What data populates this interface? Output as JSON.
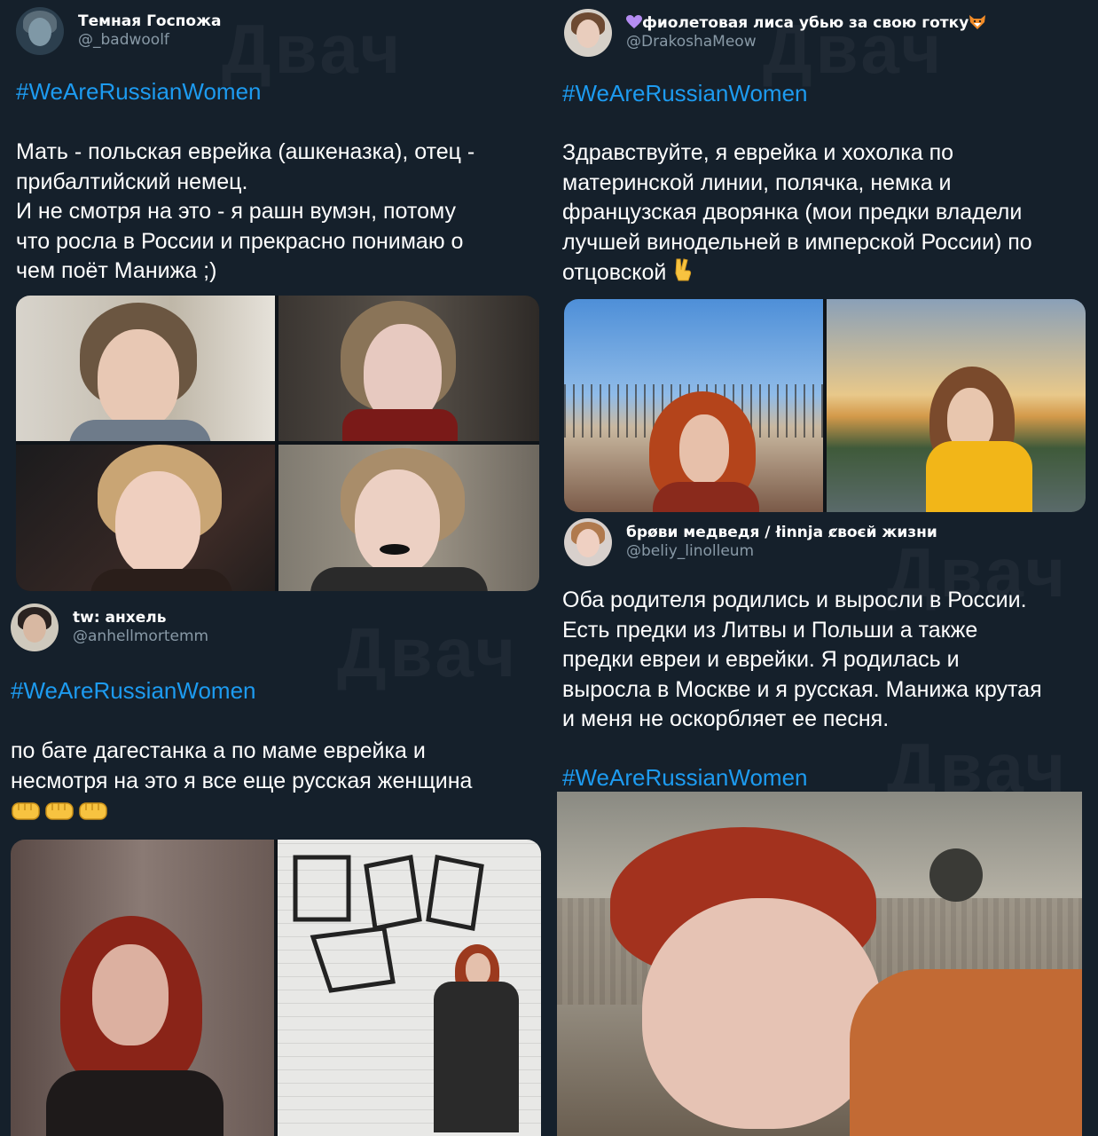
{
  "watermark": "Двач",
  "tweets": [
    {
      "display_name": "Темная Госпожа",
      "handle": "@_badwoolf",
      "hashtag": "#WeAreRussianWomen",
      "lines": [
        "Мать - польская еврейка (ашкеназка), отец -",
        "прибалтийский немец.",
        "И не смотря на это - я рашн вумэн, потому",
        "что росла в России и прекрасно понимаю о",
        "чем поёт Манижа ;)"
      ],
      "photo_count": 4
    },
    {
      "display_name": "фиолетовая лиса убью за свою готку",
      "name_prefix_icon": "purple-heart-icon",
      "name_suffix_icon": "fox-icon",
      "handle": "@DrakoshaMeow",
      "hashtag": "#WeAreRussianWomen",
      "lines": [
        "Здравствуйте, я еврейка и хохолка по",
        "материнской линии, полячка, немка и",
        "французская дворянка (мои предки владели",
        "лучшей винодельней в имперской России) по",
        "отцовской"
      ],
      "end_icon": "victory-hand-icon",
      "photo_count": 2
    },
    {
      "display_name": "tw: анхель",
      "handle": "@anhellmortemm",
      "hashtag": "#WeAreRussianWomen",
      "lines": [
        "по бате дагестанка а по маме еврейка и",
        "несмотря на это я все еще русская женщина"
      ],
      "emoji_row": [
        "fist-icon",
        "fist-icon",
        "fist-icon"
      ],
      "photo_count": 2
    },
    {
      "display_name": "брøви медведя / łinnja ȼвоєй жизни",
      "handle": "@beliy_linolleum",
      "hashtag": "#WeAreRussianWomen",
      "lines": [
        "Оба родителя родились и выросли в России.",
        "Есть предки из Литвы и Польши а также",
        "предки евреи и еврейки. Я родилась и",
        "выросла в Москве и я русская. Манижа крутая",
        "и меня не оскорбляет ее песня."
      ],
      "photo_count": 1
    }
  ],
  "colors": {
    "background": "#15202b",
    "hashtag": "#1d9bf0",
    "secondary_text": "#8899a6"
  }
}
